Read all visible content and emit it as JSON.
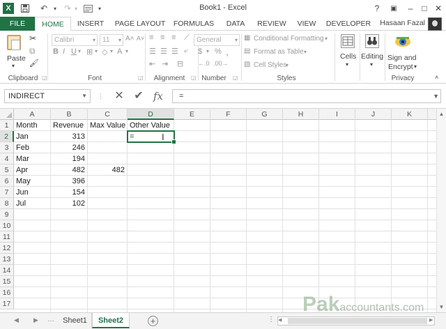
{
  "window": {
    "title": "Book1 - Excel",
    "help": "?",
    "ribbon_display": "▣",
    "minimize": "–",
    "maximize": "□",
    "close": "✕"
  },
  "qat": {
    "save": "💾",
    "undo": "↶",
    "redo": "↷",
    "customize": "▾"
  },
  "tabs": [
    "FILE",
    "HOME",
    "INSERT",
    "PAGE LAYOUT",
    "FORMULAS",
    "DATA",
    "REVIEW",
    "VIEW",
    "DEVELOPER"
  ],
  "user": {
    "name": "Hasaan Fazal"
  },
  "ribbon": {
    "clipboard": {
      "label": "Clipboard",
      "paste": "Paste"
    },
    "font": {
      "label": "Font",
      "family": "Calibri",
      "size": "11"
    },
    "alignment": {
      "label": "Alignment"
    },
    "number": {
      "label": "Number",
      "format": "General",
      "currency": "$",
      "percent": "%",
      "comma": ","
    },
    "styles": {
      "label": "Styles",
      "conditional": "Conditional Formatting",
      "format_table": "Format as Table",
      "cell_styles": "Cell Styles"
    },
    "cells": {
      "label": "Cells"
    },
    "editing": {
      "label": "Editing"
    },
    "privacy": {
      "label": "Privacy",
      "sign1": "Sign and",
      "sign2": "Encrypt"
    }
  },
  "formula_bar": {
    "name_box": "INDIRECT",
    "cancel": "✕",
    "enter": "✔",
    "fx": "fx",
    "formula": "="
  },
  "sheet": {
    "columns": [
      "A",
      "B",
      "C",
      "D",
      "E",
      "F",
      "G",
      "H",
      "I",
      "J",
      "K"
    ],
    "rows": [
      "1",
      "2",
      "3",
      "4",
      "5",
      "6",
      "7",
      "8",
      "9",
      "10",
      "11",
      "12",
      "13",
      "14",
      "15",
      "16",
      "17"
    ],
    "active_cell": {
      "value": "="
    },
    "headers": {
      "a1": "Month",
      "b1": "Revenue",
      "c1": "Max Value",
      "d1": "Other Value"
    },
    "data": [
      {
        "month": "Jan",
        "revenue": "313",
        "max": ""
      },
      {
        "month": "Feb",
        "revenue": "246",
        "max": ""
      },
      {
        "month": "Mar",
        "revenue": "194",
        "max": ""
      },
      {
        "month": "Apr",
        "revenue": "482",
        "max": "482"
      },
      {
        "month": "May",
        "revenue": "396",
        "max": ""
      },
      {
        "month": "Jun",
        "revenue": "154",
        "max": ""
      },
      {
        "month": "Jul",
        "revenue": "102",
        "max": ""
      }
    ]
  },
  "sheet_tabs": [
    "Sheet1",
    "Sheet2"
  ],
  "add_sheet": "+",
  "watermark": {
    "big": "Pak",
    "small": "accountants.com"
  }
}
